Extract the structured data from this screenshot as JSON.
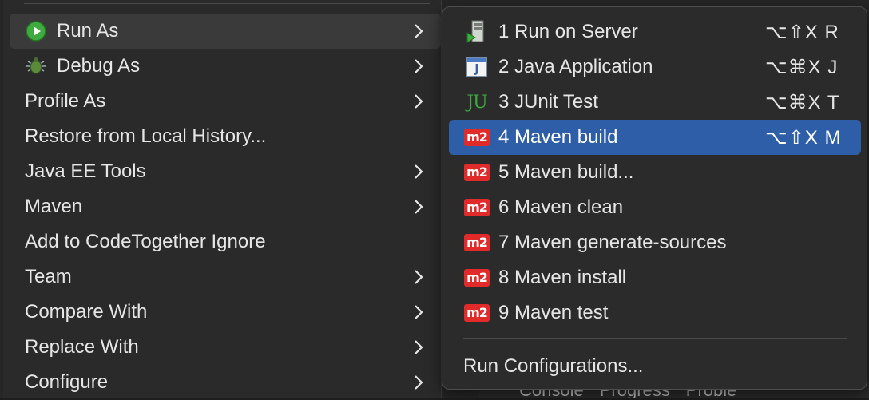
{
  "ide": {
    "bottom_tabs": [
      "Console",
      "Progress",
      "Proble"
    ]
  },
  "menu": {
    "items": [
      {
        "label": "Run As",
        "icon": "run-icon",
        "submenu": true
      },
      {
        "label": "Debug As",
        "icon": "debug-bug-icon",
        "submenu": true
      },
      {
        "label": "Profile As",
        "submenu": true
      },
      {
        "label": "Restore from Local History...",
        "submenu": false
      },
      {
        "label": "Java EE Tools",
        "submenu": true
      },
      {
        "label": "Maven",
        "submenu": true
      },
      {
        "label": "Add to CodeTogether Ignore",
        "submenu": false
      },
      {
        "label": "Team",
        "submenu": true
      },
      {
        "label": "Compare With",
        "submenu": true
      },
      {
        "label": "Replace With",
        "submenu": true
      },
      {
        "label": "Configure",
        "submenu": true
      }
    ]
  },
  "submenu": {
    "items": [
      {
        "label": "1 Run on Server",
        "shortcut": "⌥⇧X R",
        "icon": "server-icon"
      },
      {
        "label": "2 Java Application",
        "shortcut": "⌥⌘X J",
        "icon": "java-app-icon"
      },
      {
        "label": "3 JUnit Test",
        "shortcut": "⌥⌘X T",
        "icon": "junit-icon"
      },
      {
        "label": "4 Maven build",
        "shortcut": "⌥⇧X M",
        "icon": "maven-m2-icon"
      },
      {
        "label": "5 Maven build...",
        "shortcut": "",
        "icon": "maven-m2-icon"
      },
      {
        "label": "6 Maven clean",
        "shortcut": "",
        "icon": "maven-m2-icon"
      },
      {
        "label": "7 Maven generate-sources",
        "shortcut": "",
        "icon": "maven-m2-icon"
      },
      {
        "label": "8 Maven install",
        "shortcut": "",
        "icon": "maven-m2-icon"
      },
      {
        "label": "9 Maven test",
        "shortcut": "",
        "icon": "maven-m2-icon"
      }
    ],
    "m2_text": "m2",
    "junit_text": "JU",
    "java_text": "J",
    "run_configurations": "Run Configurations..."
  },
  "colors": {
    "selection": "#2f5ea8",
    "maven_red": "#e12b2b",
    "run_green": "#3faa3f"
  }
}
